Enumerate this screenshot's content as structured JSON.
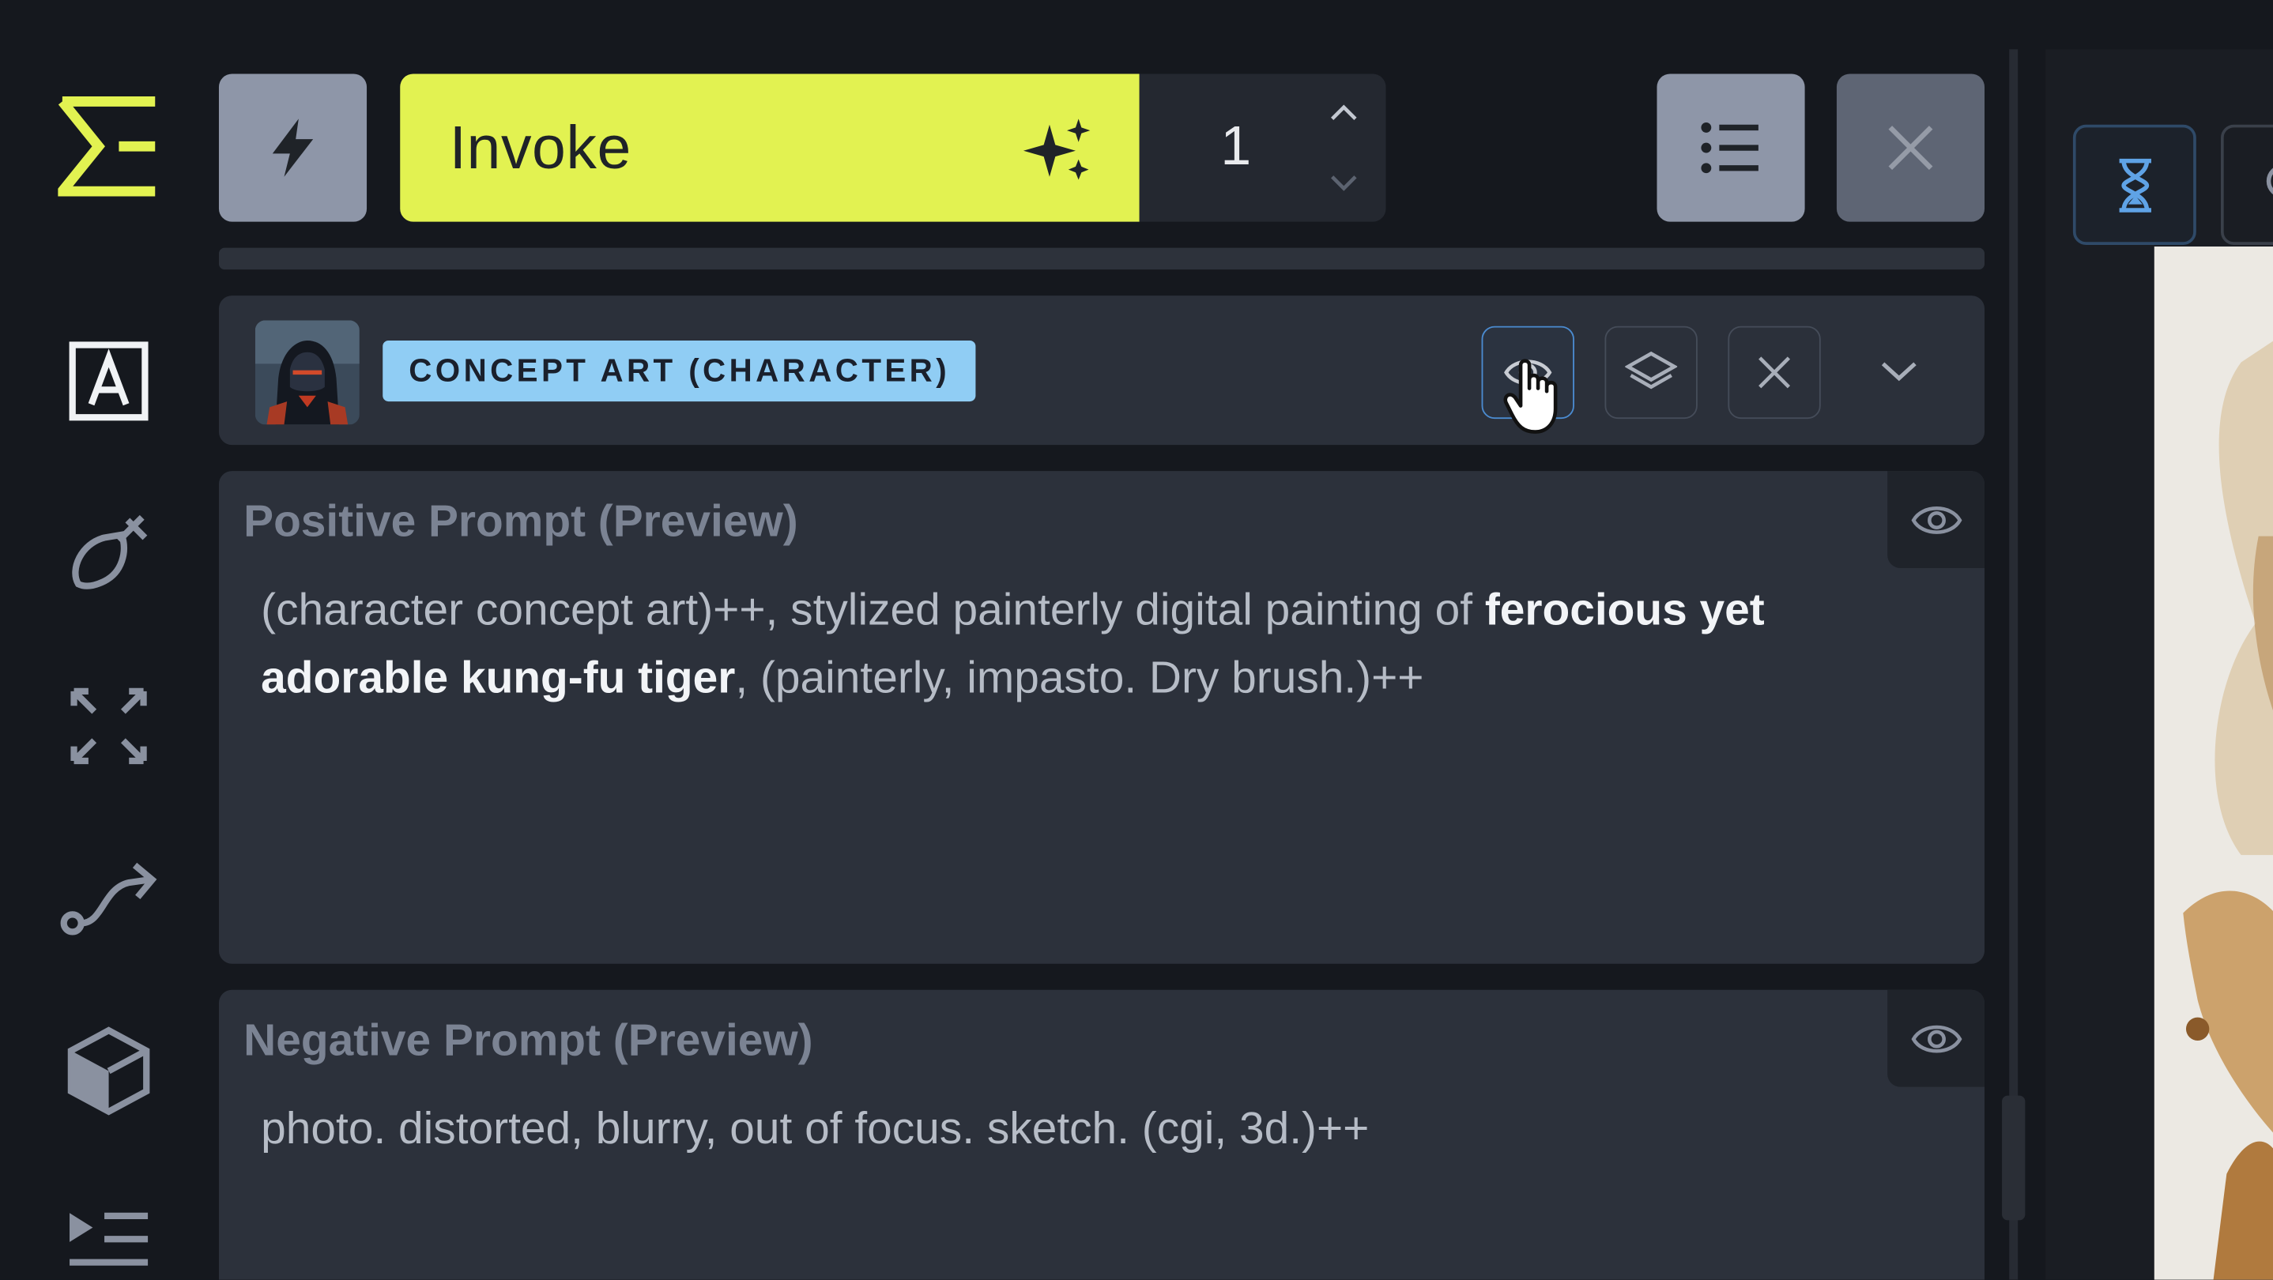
{
  "sidebar": {
    "logo": "invoke-logo-icon",
    "items": [
      {
        "name": "text-to-image-icon"
      },
      {
        "name": "canvas-brush-icon"
      },
      {
        "name": "upscale-icon"
      },
      {
        "name": "workflows-icon"
      },
      {
        "name": "models-icon"
      },
      {
        "name": "queue-icon"
      }
    ]
  },
  "toolbar": {
    "invoke_label": "Invoke",
    "iterations": "1",
    "colors": {
      "invoke": "#e2f251",
      "button": "#8e96a8"
    }
  },
  "style_preset": {
    "name": "CONCEPT ART (CHARACTER)",
    "badge_color": "#90cdf4"
  },
  "positive_prompt": {
    "title": "Positive Prompt (Preview)",
    "text_before": "(character concept art)++, stylized painterly digital painting of ",
    "text_bold": "ferocious yet adorable kung-fu tiger",
    "text_after": ", (painterly, impasto. Dry brush.)++"
  },
  "negative_prompt": {
    "title": "Negative Prompt (Preview)",
    "text": "photo. distorted, blurry, out of focus. sketch. (cgi, 3d.)++"
  }
}
